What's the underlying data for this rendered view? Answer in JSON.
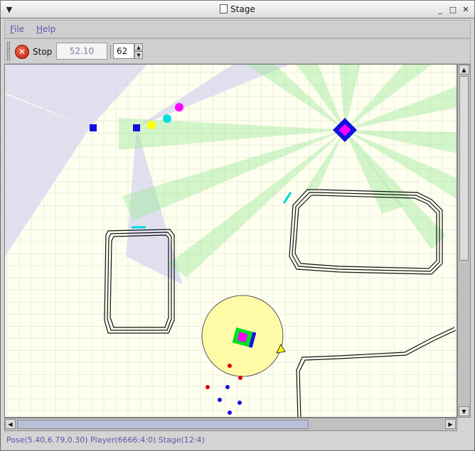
{
  "window": {
    "title": "Stage",
    "menu_icon": "window-menu-icon",
    "controls": [
      "minimize-icon",
      "maximize-icon",
      "close-icon"
    ]
  },
  "menubar": {
    "items": [
      {
        "label": "File",
        "underline": "F"
      },
      {
        "label": "Help",
        "underline": "H"
      }
    ]
  },
  "toolbar": {
    "stop_label": "Stop",
    "sim_time": "52.10",
    "rate_value": "62"
  },
  "status_bar": {
    "text": "Pose(5.40,6.79,0.30) Player(6666:4:0) Stage(12:4)"
  },
  "colors": {
    "canvas_bg": "#fffff0",
    "grid": "#d8ddd0",
    "laser_green": "#b8f0b0",
    "sonar_lavender": "#d8d8f0",
    "robot_blue": "#1010e0",
    "robot_magenta": "#ff00ff",
    "fiducial_cyan": "#00e0e0",
    "accent_yellow": "#ffff00",
    "selection_circle": "#fffaaa"
  },
  "icons": {
    "stop": "stop-icon",
    "document": "document-icon"
  }
}
